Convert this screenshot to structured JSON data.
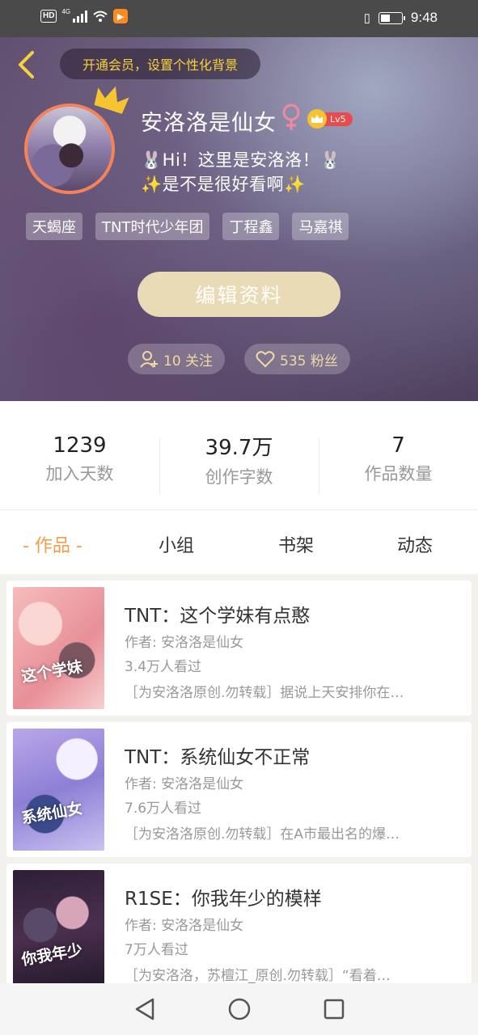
{
  "status_bar": {
    "time": "9:48",
    "network": "4G",
    "hd_badge": "HD",
    "app_badge_icon": "play-icon"
  },
  "header": {
    "vip_prompt": "开通会员，设置个性化背景",
    "username": "安洛洛是仙女",
    "level": "Lv5",
    "bio_line1": "🐰Hi！这里是安洛洛！🐰",
    "bio_line2": "✨是不是很好看啊✨",
    "tags": [
      "天蝎座",
      "TNT时代少年团",
      "丁程鑫",
      "马嘉祺"
    ],
    "edit_button": "编辑资料",
    "following": "10 关注",
    "fans": "535 粉丝"
  },
  "stats": [
    {
      "value": "1239",
      "label": "加入天数"
    },
    {
      "value": "39.7万",
      "label": "创作字数"
    },
    {
      "value": "7",
      "label": "作品数量"
    }
  ],
  "tabs": [
    {
      "label": "- 作品 -",
      "active": true
    },
    {
      "label": "小组",
      "active": false
    },
    {
      "label": "书架",
      "active": false
    },
    {
      "label": "动态",
      "active": false
    }
  ],
  "books": [
    {
      "title": "TNT：这个学妹有点憨",
      "author": "作者: 安洛洛是仙女",
      "views": "3.4万人看过",
      "desc": "［为安洛洛原创.勿转载］据说上天安排你在…",
      "cover_text": "这个学妹"
    },
    {
      "title": "TNT：系统仙女不正常",
      "author": "作者: 安洛洛是仙女",
      "views": "7.6万人看过",
      "desc": "［为安洛洛原创.勿转载］在A市最出名的爆…",
      "cover_text": "系统仙女"
    },
    {
      "title": "R1SE：你我年少的模样",
      "author": "作者: 安洛洛是仙女",
      "views": "7万人看过",
      "desc": "［为安洛洛，苏檀江_原创.勿转载］“看着…",
      "cover_text": "你我年少"
    }
  ],
  "colors": {
    "accent_orange": "#f39c4a",
    "vip_yellow": "#f6d33a",
    "edit_button_bg": "#e9dbb6",
    "level_red": "#e74b4b"
  }
}
